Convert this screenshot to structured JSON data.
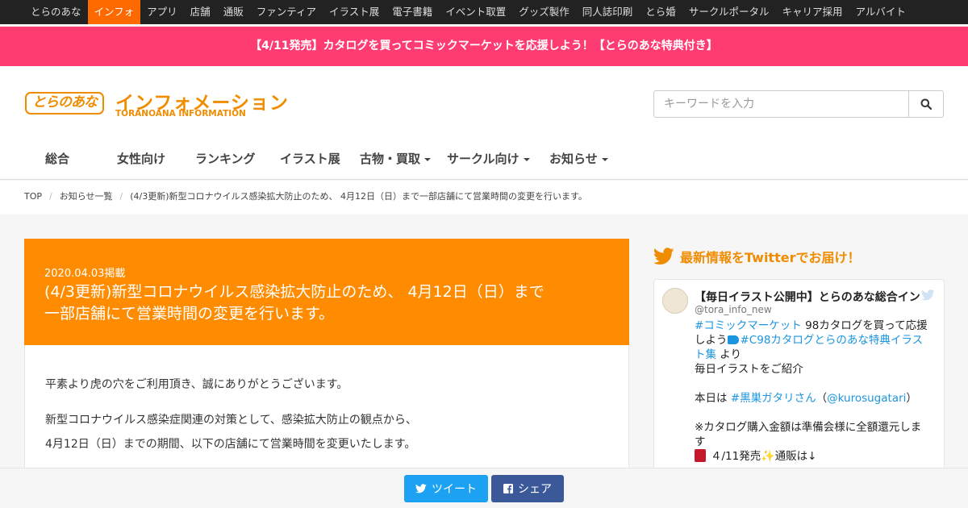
{
  "topnav": [
    {
      "label": "とらのあな",
      "active": false
    },
    {
      "label": "インフォ",
      "active": true
    },
    {
      "label": "アプリ",
      "active": false
    },
    {
      "label": "店舗",
      "active": false
    },
    {
      "label": "通販",
      "active": false
    },
    {
      "label": "ファンティア",
      "active": false
    },
    {
      "label": "イラスト展",
      "active": false
    },
    {
      "label": "電子書籍",
      "active": false
    },
    {
      "label": "イベント取置",
      "active": false
    },
    {
      "label": "グッズ製作",
      "active": false
    },
    {
      "label": "同人誌印刷",
      "active": false
    },
    {
      "label": "とら婚",
      "active": false
    },
    {
      "label": "サークルポータル",
      "active": false
    },
    {
      "label": "キャリア採用",
      "active": false
    },
    {
      "label": "アルバイト",
      "active": false
    }
  ],
  "banner": {
    "text": "【4/11発売】カタログを買ってコミックマーケットを応援しよう！【とらのあな特典付き】"
  },
  "header": {
    "logo_text": "とらのあな",
    "title": "インフォメーション",
    "subtitle": "TORANOANA INFORMATION",
    "search_placeholder": "キーワードを入力"
  },
  "gnav": [
    {
      "label": "総合",
      "dropdown": false
    },
    {
      "label": "女性向け",
      "dropdown": false
    },
    {
      "label": "ランキング",
      "dropdown": false
    },
    {
      "label": "イラスト展",
      "dropdown": false
    },
    {
      "label": "古物・買取",
      "dropdown": true
    },
    {
      "label": "サークル向け",
      "dropdown": true
    },
    {
      "label": "お知らせ",
      "dropdown": true
    }
  ],
  "breadcrumb": [
    "TOP",
    "お知らせ一覧",
    "(4/3更新)新型コロナウイルス感染拡大防止のため、 4月12日（日）まで一部店舗にて営業時間の変更を行います。"
  ],
  "article": {
    "date": "2020.04.03掲載",
    "title_line1": "(4/3更新)新型コロナウイルス感染拡大防止のため、 4月12日（日）まで",
    "title_line2": "一部店舗にて営業時間の変更を行います。",
    "para1": "平素より虎の穴をご利用頂き、誠にありがとうございます。",
    "para2_line1": "新型コロナウイルス感染症関連の対策として、感染拡大防止の観点から、",
    "para2_line2": "4月12日（日）までの期間、以下の店舗にて営業時間を変更いたします。"
  },
  "twitter": {
    "heading": "最新情報をTwitterでお届け！",
    "name": "【毎日イラスト公開中】とらのあな総合イン",
    "handle": "@tora_info_new",
    "hashtag1": "#コミックマーケット",
    "text1": " 98カタログを買って応援",
    "text2": "しよう",
    "hashtag2": "#C98カタログとらのあな特典イラス",
    "hashtag2_cont": "ト集",
    "text3": " より",
    "text4": "毎日イラストをご紹介",
    "text5": "本日は ",
    "hashtag3": "#黒巣ガタリさん",
    "paren_open": "（",
    "mention": "@kurosugatari",
    "paren_close": "）",
    "text6": "※カタログ購入金額は準備会様に全額還元しま",
    "text7": "す",
    "text8": "４/11発売",
    "text9": "通販は↓"
  },
  "share": {
    "tweet_label": "ツイート",
    "share_label": "シェア"
  },
  "colors": {
    "accent": "#ff8c00",
    "banner": "#ff3c72",
    "topbar": "#222222",
    "twitter": "#1da1f2",
    "facebook": "#3b5998"
  }
}
